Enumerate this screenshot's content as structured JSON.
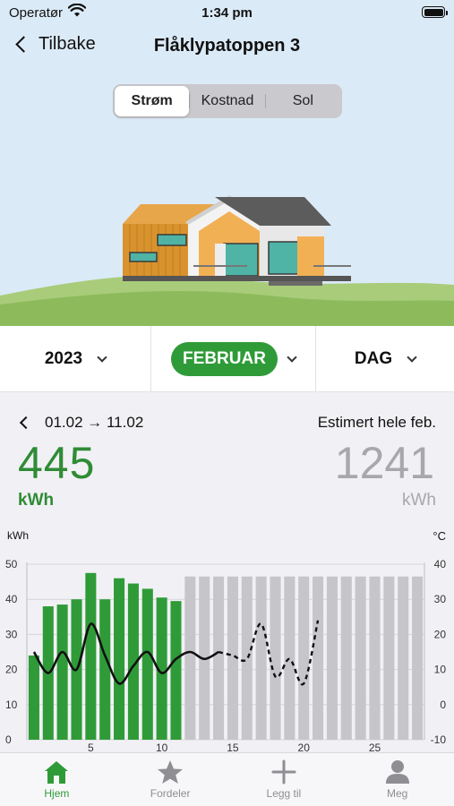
{
  "status_bar": {
    "carrier": "Operatør",
    "time": "1:34 pm"
  },
  "nav": {
    "back_label": "Tilbake",
    "title": "Flåklypatoppen 3"
  },
  "segments": [
    {
      "label": "Strøm",
      "active": true
    },
    {
      "label": "Kostnad",
      "active": false
    },
    {
      "label": "Sol",
      "active": false
    }
  ],
  "selectors": {
    "year": "2023",
    "month": "FEBRUAR",
    "granularity": "DAG"
  },
  "summary": {
    "range": "01.02 → 11.02",
    "value": "445",
    "unit": "kWh",
    "estimate_label": "Estimert hele feb.",
    "estimate_value": "1241",
    "estimate_unit": "kWh"
  },
  "colors": {
    "accent": "#2f9b38",
    "estimate": "#c6c6ca",
    "sky": "#dbeaf7",
    "grass": "#9cc56a"
  },
  "chart_data": {
    "type": "bar",
    "y_left_label": "kWh",
    "y_right_label": "°C",
    "y_left_range": [
      0,
      50
    ],
    "y_left_ticks": [
      0,
      10,
      20,
      30,
      40,
      50
    ],
    "y_right_range": [
      -10,
      40
    ],
    "y_right_ticks": [
      -10,
      0,
      10,
      20,
      30,
      40
    ],
    "x_ticks": [
      5,
      10,
      15,
      20,
      25
    ],
    "days": [
      1,
      2,
      3,
      4,
      5,
      6,
      7,
      8,
      9,
      10,
      11,
      12,
      13,
      14,
      15,
      16,
      17,
      18,
      19,
      20,
      21,
      22,
      23,
      24,
      25,
      26,
      27,
      28
    ],
    "series": [
      {
        "name": "",
        "values": [
          24,
          38,
          38.5,
          40,
          47.5,
          40,
          46,
          44.5,
          43,
          40.5,
          39.5
        ]
      },
      {
        "name": "",
        "values": [
          46.5,
          46.5,
          46.5,
          46.5,
          46.5,
          46.5,
          46.5,
          46.5,
          46.5,
          46.5,
          46.5,
          46.5,
          46.5,
          46.5,
          46.5,
          46.5,
          46.5
        ]
      }
    ],
    "temperature_actual": {
      "x": [
        1,
        2,
        3,
        4,
        5,
        6,
        7,
        8,
        9,
        10,
        11,
        12,
        13,
        14
      ],
      "y": [
        15,
        9,
        15,
        10,
        23,
        14,
        6,
        11,
        15,
        9,
        13,
        15,
        13,
        15
      ]
    },
    "temperature_forecast": {
      "x": [
        14,
        15,
        16,
        17,
        18,
        19,
        20,
        21
      ],
      "y": [
        15,
        14,
        13,
        23,
        8,
        13,
        6,
        24
      ]
    }
  },
  "tabs": [
    {
      "label": "Hjem",
      "icon": "home-icon",
      "active": true
    },
    {
      "label": "Fordeler",
      "icon": "star-icon",
      "active": false
    },
    {
      "label": "Legg til",
      "icon": "plus-icon",
      "active": false
    },
    {
      "label": "Meg",
      "icon": "person-icon",
      "active": false
    }
  ]
}
